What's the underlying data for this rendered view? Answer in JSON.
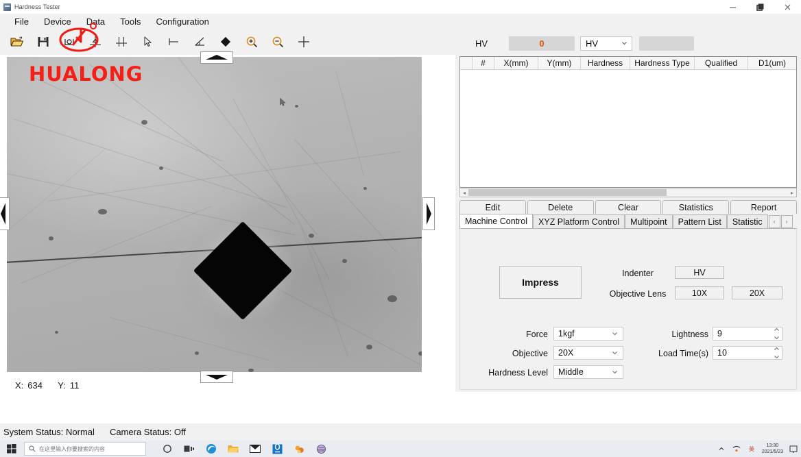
{
  "window": {
    "title": "Hardness Tester",
    "minimize_label": "minimize",
    "maximize_label": "restore",
    "close_label": "close"
  },
  "menubar": {
    "items": [
      {
        "label": "File"
      },
      {
        "label": "Device"
      },
      {
        "label": "Data"
      },
      {
        "label": "Tools"
      },
      {
        "label": "Configuration"
      }
    ]
  },
  "toolbar": {
    "items": [
      {
        "icon": "open-folder-icon"
      },
      {
        "icon": "save-disk-icon"
      },
      {
        "icon": "measure-length-icon"
      },
      {
        "icon": "crosshair-point-icon"
      },
      {
        "icon": "crosshair-line-icon"
      },
      {
        "icon": "pointer-arrow-icon"
      },
      {
        "icon": "horizontal-measure-icon"
      },
      {
        "icon": "angle-measure-icon"
      },
      {
        "icon": "diamond-indent-icon"
      },
      {
        "icon": "zoom-in-icon"
      },
      {
        "icon": "zoom-out-icon"
      },
      {
        "icon": "crosshair-plus-icon"
      }
    ]
  },
  "annotation": {
    "shape": "red-circle-highlight"
  },
  "camera_view": {
    "watermark": "HUALONG",
    "coordinates": {
      "x_label": "X:",
      "x_value": "634",
      "y_label": "Y:",
      "y_value": "11"
    }
  },
  "measurement": {
    "type_label": "HV",
    "value": "0",
    "scale_selected": "HV",
    "blank_field": ""
  },
  "results_table": {
    "columns": [
      "",
      "#",
      "X(mm)",
      "Y(mm)",
      "Hardness",
      "Hardness Type",
      "Qualified",
      "D1(um)"
    ],
    "rows": []
  },
  "action_buttons": [
    {
      "label": "Edit"
    },
    {
      "label": "Delete"
    },
    {
      "label": "Clear"
    },
    {
      "label": "Statistics"
    },
    {
      "label": "Report"
    }
  ],
  "tabs": {
    "items": [
      {
        "label": "Machine Control",
        "active": true
      },
      {
        "label": "XYZ Platform Control",
        "active": false
      },
      {
        "label": "Multipoint",
        "active": false
      },
      {
        "label": "Pattern List",
        "active": false
      },
      {
        "label": "Statistic",
        "active": false
      }
    ],
    "nav_prev": "‹",
    "nav_next": "›"
  },
  "machine_control": {
    "impress_label": "Impress",
    "indenter_label": "Indenter",
    "indenter_value": "HV",
    "objective_lens_label": "Objective Lens",
    "objective_lens_10": "10X",
    "objective_lens_20": "20X",
    "fields": {
      "force_label": "Force",
      "force_value": "1kgf",
      "objective_label": "Objective",
      "objective_value": "20X",
      "hardness_level_label": "Hardness Level",
      "hardness_level_value": "Middle",
      "lightness_label": "Lightness",
      "lightness_value": "9",
      "load_time_label": "Load Time(s)",
      "load_time_value": "10"
    }
  },
  "statusbar": {
    "system_status": "System Status: Normal",
    "camera_status": "Camera Status: Off"
  },
  "taskbar": {
    "search_placeholder": "在这里输入你要搜索的内容",
    "apps": [
      {
        "icon": "cortana-circle-icon"
      },
      {
        "icon": "task-view-icon"
      },
      {
        "icon": "edge-browser-icon"
      },
      {
        "icon": "file-explorer-icon"
      },
      {
        "icon": "mail-icon"
      },
      {
        "icon": "teams-icon"
      },
      {
        "icon": "app-orange-icon"
      },
      {
        "icon": "hardness-tester-app-icon"
      }
    ],
    "tray": [
      {
        "icon": "tray-chevron-icon"
      },
      {
        "icon": "network-icon"
      },
      {
        "icon": "ime-icon"
      }
    ],
    "clock_time": "13:30",
    "clock_date": "2021/5/23",
    "notification_icon": "notification-icon"
  },
  "colors": {
    "accent_red": "#f42018",
    "value_orange": "#e8540d",
    "panel_bg": "#f1f1f1",
    "taskbar_bg": "#e9edf2"
  }
}
